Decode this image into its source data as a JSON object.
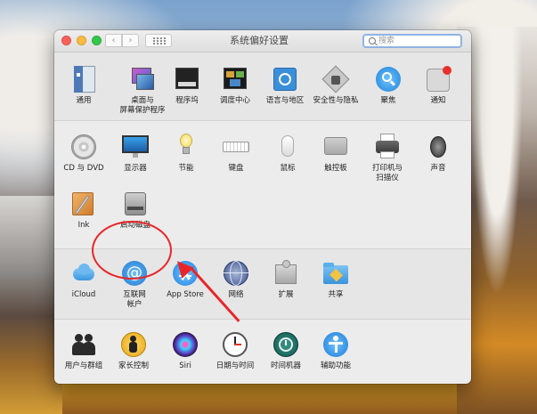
{
  "window": {
    "title": "系统偏好设置",
    "search_placeholder": "搜索",
    "nav_back": "‹",
    "nav_forward": "›"
  },
  "sections": [
    {
      "items": [
        {
          "label": "通用",
          "icon": "general-icon"
        },
        {
          "label": "桌面与\n屏幕保护程序",
          "icon": "desktop-screensaver-icon"
        },
        {
          "label": "程序坞",
          "icon": "dock-icon"
        },
        {
          "label": "调度中心",
          "icon": "mission-control-icon"
        },
        {
          "label": "语言与地区",
          "icon": "language-region-icon"
        },
        {
          "label": "安全性与隐私",
          "icon": "security-privacy-icon"
        },
        {
          "label": "聚焦",
          "icon": "spotlight-icon"
        },
        {
          "label": "通知",
          "icon": "notifications-icon"
        }
      ]
    },
    {
      "items": [
        {
          "label": "CD 与 DVD",
          "icon": "cd-dvd-icon"
        },
        {
          "label": "显示器",
          "icon": "displays-icon"
        },
        {
          "label": "节能",
          "icon": "energy-saver-icon"
        },
        {
          "label": "键盘",
          "icon": "keyboard-icon"
        },
        {
          "label": "鼠标",
          "icon": "mouse-icon"
        },
        {
          "label": "触控板",
          "icon": "trackpad-icon"
        },
        {
          "label": "打印机与\n扫描仪",
          "icon": "printer-scanner-icon"
        },
        {
          "label": "声音",
          "icon": "sound-icon"
        },
        {
          "label": "Ink",
          "icon": "ink-icon"
        },
        {
          "label": "启动磁盘",
          "icon": "startup-disk-icon"
        }
      ]
    },
    {
      "items": [
        {
          "label": "iCloud",
          "icon": "icloud-icon"
        },
        {
          "label": "互联网\n帐户",
          "icon": "internet-accounts-icon"
        },
        {
          "label": "App Store",
          "icon": "app-store-icon"
        },
        {
          "label": "网络",
          "icon": "network-icon"
        },
        {
          "label": "扩展",
          "icon": "extensions-icon"
        },
        {
          "label": "共享",
          "icon": "sharing-icon"
        }
      ]
    },
    {
      "items": [
        {
          "label": "用户与群组",
          "icon": "users-groups-icon"
        },
        {
          "label": "家长控制",
          "icon": "parental-controls-icon"
        },
        {
          "label": "Siri",
          "icon": "siri-icon"
        },
        {
          "label": "日期与时间",
          "icon": "date-time-icon"
        },
        {
          "label": "时间机器",
          "icon": "time-machine-icon"
        },
        {
          "label": "辅助功能",
          "icon": "accessibility-icon"
        }
      ]
    }
  ],
  "annotation": {
    "highlight_target": "App Store",
    "color": "#e8262a"
  }
}
